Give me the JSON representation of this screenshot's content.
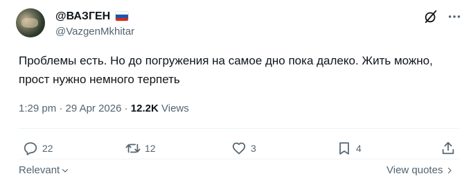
{
  "author": {
    "display_name": "@ВАЗГЕН",
    "handle": "@VazgenMkhitar",
    "flag_icon": "russia-flag-icon"
  },
  "tweet": {
    "text": "Проблемы есть. Но до погружения на самое дно пока далеко. Жить можно, прост нужно немного терпеть"
  },
  "meta": {
    "time": "1:29 pm",
    "separator": "·",
    "date": "29 Apr 2026",
    "views_count": "12.2K",
    "views_label": "Views"
  },
  "actions": {
    "reply_count": "22",
    "repost_count": "12",
    "like_count": "3",
    "bookmark_count": "4"
  },
  "footer": {
    "sort_label": "Relevant",
    "view_quotes_label": "View quotes"
  },
  "colors": {
    "text": "#0f1419",
    "secondary": "#536471",
    "divider": "#eff3f4"
  }
}
